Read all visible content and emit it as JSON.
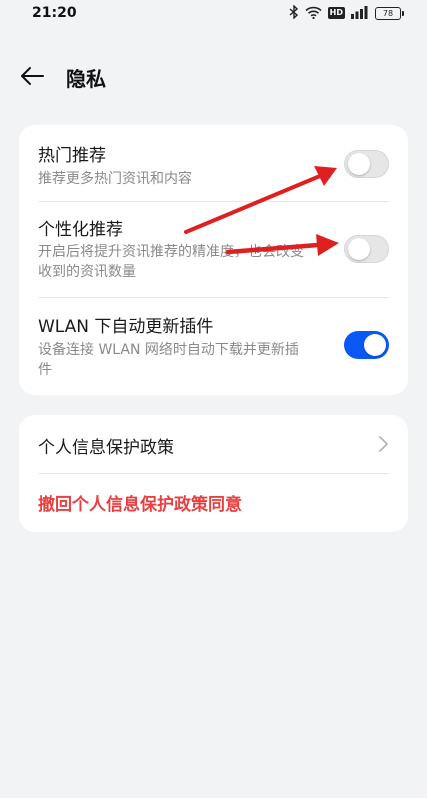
{
  "status_bar": {
    "time": "21:20",
    "icons": [
      "bluetooth-icon",
      "wifi-icon",
      "hd-icon",
      "cellular-signal-icon",
      "battery-icon"
    ],
    "hd_label": "HD",
    "battery_level": "78"
  },
  "header": {
    "back_icon": "back-arrow-icon",
    "title": "隐私"
  },
  "settings": [
    {
      "title": "热门推荐",
      "subtitle": "推荐更多热门资讯和内容",
      "toggle_on": false
    },
    {
      "title": "个性化推荐",
      "subtitle": "开启后将提升资讯推荐的精准度，也会改变收到的资讯数量",
      "toggle_on": false
    },
    {
      "title": "WLAN 下自动更新插件",
      "subtitle": "设备连接 WLAN 网络时自动下载并更新插件",
      "toggle_on": true
    }
  ],
  "policy": {
    "link_label": "个人信息保护政策",
    "revoke_label": "撤回个人信息保护政策同意"
  },
  "colors": {
    "background": "#f1f3f5",
    "card": "#ffffff",
    "accent": "#0a59f7",
    "danger": "#e84040",
    "annotation_arrow": "#e02020"
  }
}
